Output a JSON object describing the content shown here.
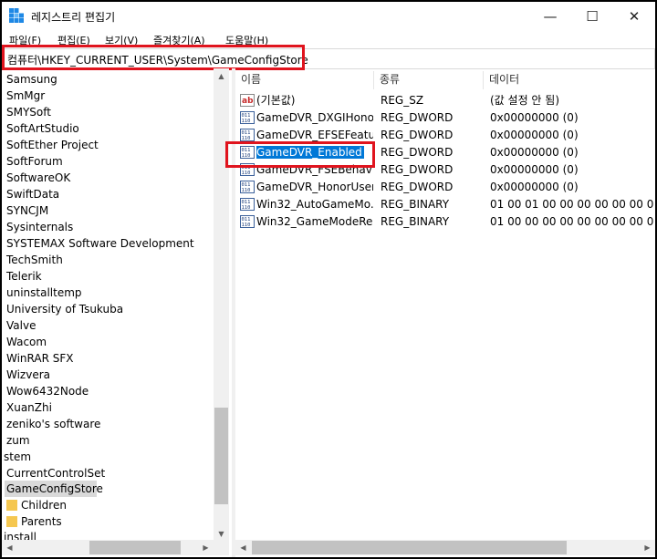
{
  "window": {
    "title": "레지스트리 편집기",
    "controls": {
      "minimize": "—",
      "maximize": "☐",
      "close": "✕"
    }
  },
  "menu": [
    "파일(F)",
    "편집(E)",
    "보기(V)",
    "즐겨찾기(A)",
    "도움말(H)"
  ],
  "address": "컴퓨터\\HKEY_CURRENT_USER\\System\\GameConfigStore",
  "tree": {
    "items": [
      "Samsung",
      "SmMgr",
      "SMYSoft",
      "SoftArtStudio",
      "SoftEther Project",
      "SoftForum",
      "SoftwareOK",
      "SwiftData",
      "SYNCJM",
      "Sysinternals",
      "SYSTEMAX Software Development",
      "TechSmith",
      "Telerik",
      "uninstalltemp",
      "University of Tsukuba",
      "Valve",
      "Wacom",
      "WinRAR SFX",
      "Wizvera",
      "Wow6432Node",
      "XuanZhi",
      "zeniko's software",
      "zum"
    ],
    "system": "stem",
    "current_control_set": "CurrentControlSet",
    "selected": "GameConfigStore",
    "children": [
      "Children",
      "Parents"
    ],
    "install": "install"
  },
  "columns": {
    "name": "이름",
    "type": "종류",
    "data": "데이터"
  },
  "values": [
    {
      "icon": "string",
      "name": "(기본값)",
      "type": "REG_SZ",
      "data": "(값 설정 안 됨)"
    },
    {
      "icon": "binary",
      "name": "GameDVR_DXGIHono...",
      "type": "REG_DWORD",
      "data": "0x00000000 (0)"
    },
    {
      "icon": "binary",
      "name": "GameDVR_EFSEFeatur...",
      "type": "REG_DWORD",
      "data": "0x00000000 (0)"
    },
    {
      "icon": "binary",
      "name": "GameDVR_Enabled",
      "type": "REG_DWORD",
      "data": "0x00000000 (0)"
    },
    {
      "icon": "binary",
      "name": "GameDVR_FSEBehavi...",
      "type": "REG_DWORD",
      "data": "0x00000000 (0)"
    },
    {
      "icon": "binary",
      "name": "GameDVR_HonorUser...",
      "type": "REG_DWORD",
      "data": "0x00000000 (0)"
    },
    {
      "icon": "binary",
      "name": "Win32_AutoGameMo...",
      "type": "REG_BINARY",
      "data": "01 00 01 00 00 00 00 00 00 00"
    },
    {
      "icon": "binary",
      "name": "Win32_GameModeRel...",
      "type": "REG_BINARY",
      "data": "01 00 00 00 00 00 00 00 00 00"
    }
  ],
  "scroll": {
    "up": "▲",
    "down": "▼",
    "left": "◀",
    "right": "▶"
  },
  "colors": {
    "highlight": "#e0141e",
    "selection": "#0078d7"
  }
}
